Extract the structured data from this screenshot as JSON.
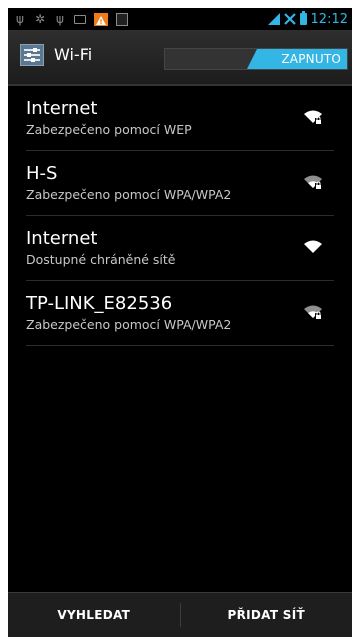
{
  "status_bar": {
    "time": "12:12",
    "left_icons": [
      "usb-icon",
      "debug-icon",
      "usb-icon",
      "battery-icon",
      "warning-icon",
      "nfc-icon"
    ],
    "right_icons": [
      "signal-icon",
      "airplane-mode-icon",
      "battery-icon"
    ]
  },
  "action_bar": {
    "icon": "wifi-settings-icon",
    "title": "Wi-Fi",
    "toggle_label": "ZAPNUTO",
    "toggle_state": "on"
  },
  "networks": [
    {
      "ssid": "Internet",
      "security": "Zabezpečeno pomocí WEP",
      "locked": true
    },
    {
      "ssid": "H-S",
      "security": "Zabezpečeno pomocí WPA/WPA2",
      "locked": true
    },
    {
      "ssid": "Internet",
      "security": "Dostupné chráněné sítě",
      "locked": false
    },
    {
      "ssid": "TP-LINK_E82536",
      "security": "Zabezpečeno pomocí WPA/WPA2",
      "locked": true
    }
  ],
  "bottom_bar": {
    "scan_label": "VYHLEDAT",
    "add_network_label": "PŘIDAT SÍŤ"
  },
  "colors": {
    "accent": "#33b5e5",
    "background": "#000000",
    "warning": "#f07b1a"
  }
}
